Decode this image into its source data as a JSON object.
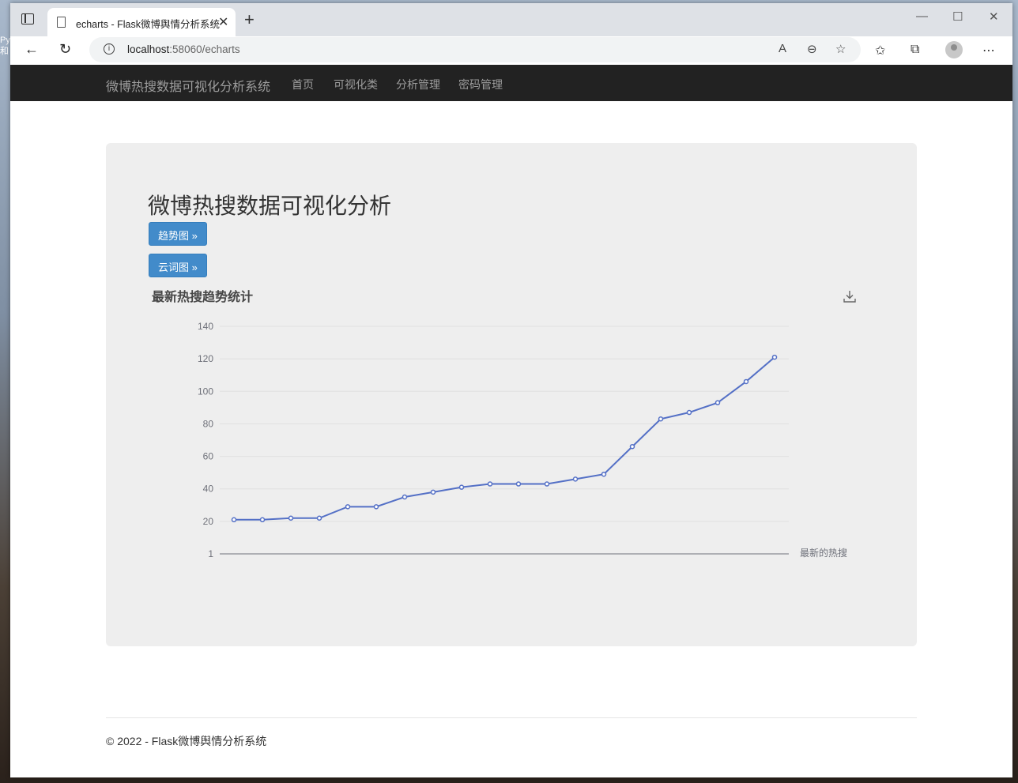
{
  "browser": {
    "tab_title": "echarts - Flask微博舆情分析系统",
    "url_host": "localhost",
    "url_path": ":58060/echarts",
    "desktop_text": "Py\n和"
  },
  "navbar": {
    "brand": "微博热搜数据可视化分析系统",
    "links": [
      "首页",
      "可视化类",
      "分析管理",
      "密码管理"
    ]
  },
  "main": {
    "title": "微博热搜数据可视化分析",
    "buttons": [
      "趋势图 »",
      "云词图 »"
    ]
  },
  "chart_data": {
    "type": "line",
    "title": "最新热搜趋势统计",
    "xlabel": "最新的热搜",
    "ylabel": "",
    "yticks": [
      1,
      20,
      40,
      60,
      80,
      100,
      120,
      140
    ],
    "ylim": [
      1,
      140
    ],
    "grid": true,
    "color": "#5470c6",
    "values": [
      21,
      21,
      22,
      22,
      29,
      29,
      35,
      38,
      41,
      43,
      43,
      43,
      46,
      49,
      66,
      83,
      87,
      93,
      106,
      121
    ]
  },
  "footer": {
    "text": "© 2022 - Flask微博舆情分析系统"
  }
}
